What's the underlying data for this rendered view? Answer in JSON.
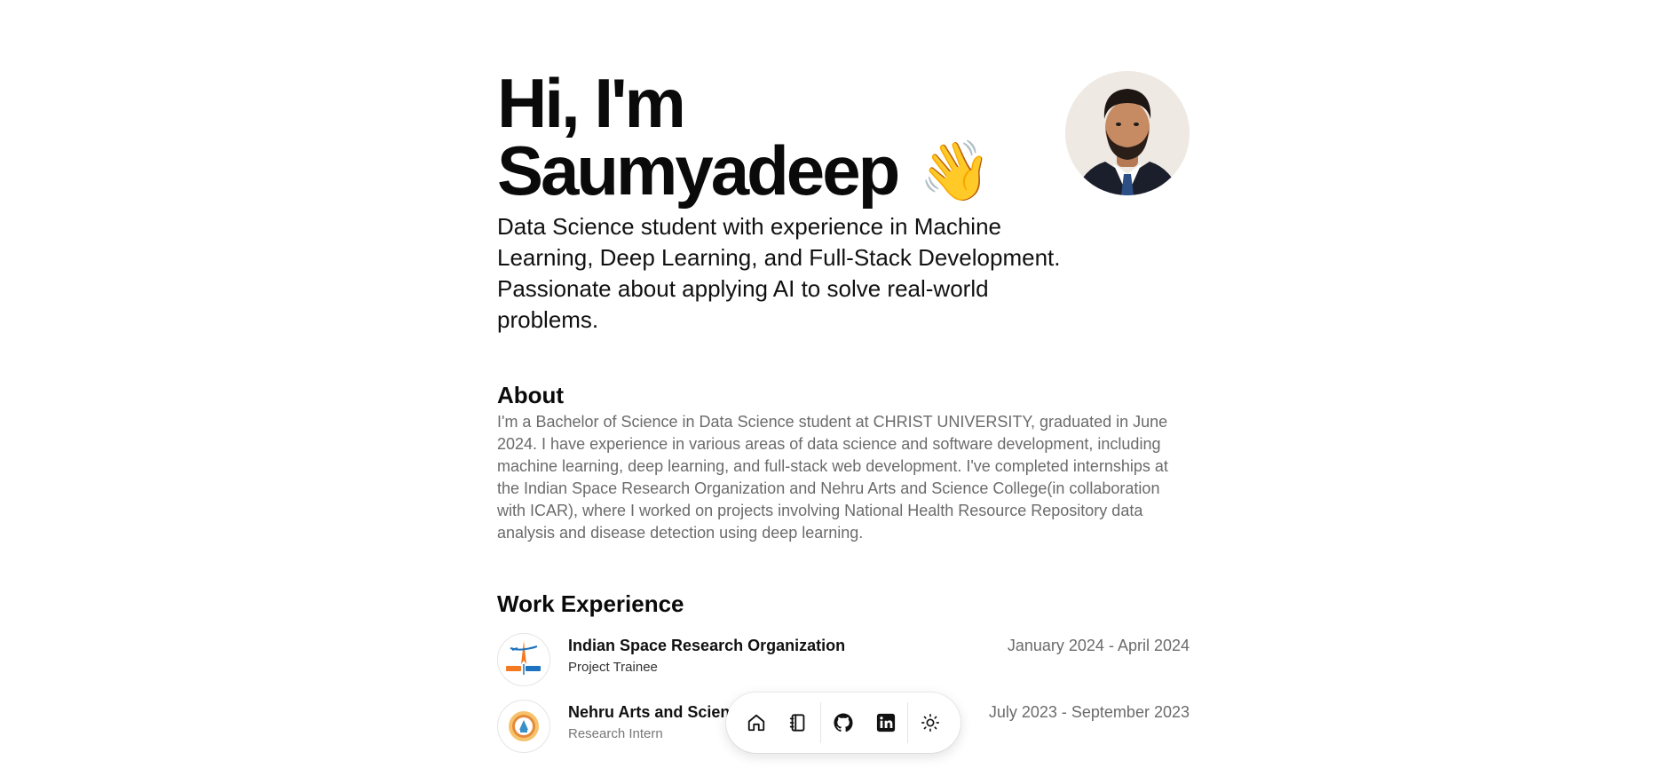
{
  "hero": {
    "title_line1": "Hi, I'm",
    "title_line2": "Saumyadeep",
    "wave_emoji": "👋",
    "tagline": "Data Science student with experience in Machine Learning, Deep Learning, and Full-Stack Development. Passionate about applying AI to solve real-world problems."
  },
  "about": {
    "heading": "About",
    "text": "I'm a Bachelor of Science in Data Science student at CHRIST UNIVERSITY, graduated in June 2024. I have experience in various areas of data science and software development, including machine learning, deep learning, and full-stack web development. I've completed internships at the Indian Space Research Organization and Nehru Arts and Science College(in collaboration with ICAR), where I worked on projects involving National Health Resource Repository data analysis and disease detection using deep learning."
  },
  "work": {
    "heading": "Work Experience",
    "items": [
      {
        "company": "Indian Space Research Organization",
        "role": "Project Trainee",
        "dates": "January 2024 - April 2024",
        "logo_icon": "isro-logo"
      },
      {
        "company": "Nehru Arts and Science College",
        "role": "Research Intern",
        "dates": "July 2023 - September 2023",
        "logo_icon": "nehru-college-logo"
      }
    ]
  },
  "dock": {
    "items": [
      {
        "icon": "home-icon"
      },
      {
        "icon": "notebook-icon"
      },
      {
        "icon": "github-icon"
      },
      {
        "icon": "linkedin-icon"
      },
      {
        "icon": "sun-icon"
      }
    ]
  },
  "colors": {
    "text": "#0a0a0a",
    "muted": "#6b6b6b",
    "background": "#ffffff",
    "isro_orange": "#f47920",
    "isro_blue": "#1e73be"
  }
}
